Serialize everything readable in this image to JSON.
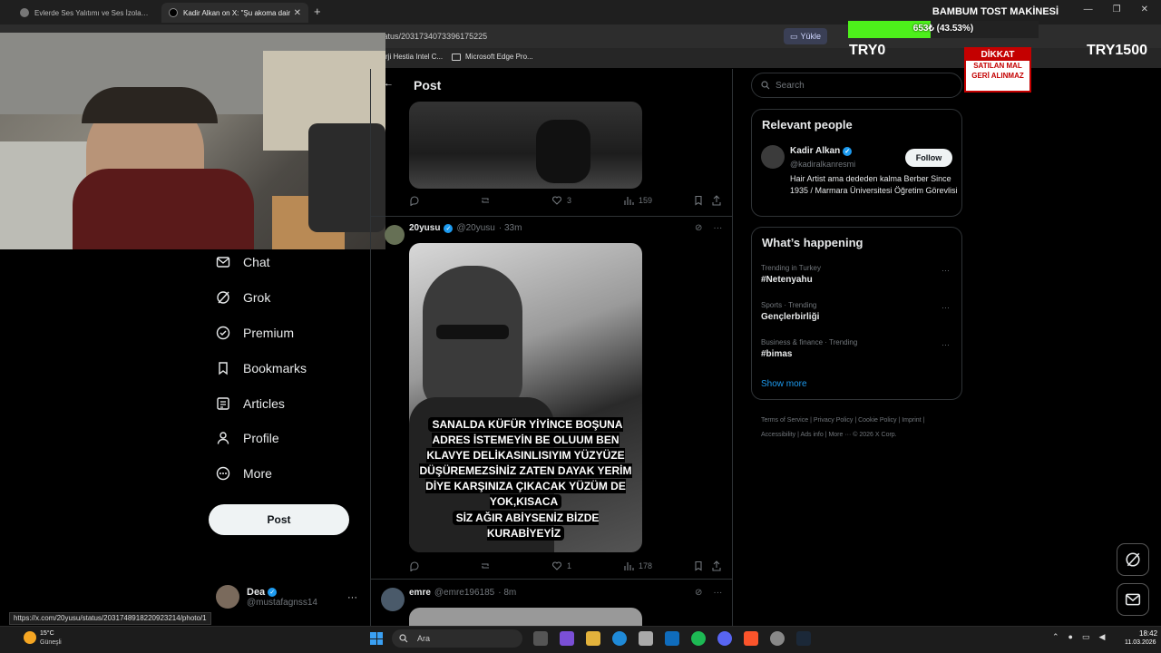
{
  "browser": {
    "tabs": [
      {
        "title": "Evlerde Ses Yalıtımı ve Ses İzolasyonu"
      },
      {
        "title": "Kadir Alkan on X: \"Şu akoma dair",
        "close": "✕"
      }
    ],
    "new_tab": "+",
    "url": "tatus/2031734073396175225",
    "yukle": "Yükle",
    "bookmarks": [
      "rji Hestia Intel C...",
      "Microsoft Edge Pro..."
    ],
    "status_url": "https://x.com/20yusu/status/2031748918220923214/photo/1"
  },
  "overlay": {
    "title": "BAMBUM TOST MAKİNESİ",
    "progress_text": "653₺ (43.53%)",
    "progress_fraction": 0.4353,
    "start": "TRY0",
    "goal": "TRY1500",
    "notice": {
      "head": "DİKKAT",
      "line1": "SATILAN MAL",
      "line2": "GERİ ALINMAZ"
    }
  },
  "nav": {
    "items": [
      {
        "label": "Chat",
        "icon": "chat-icon"
      },
      {
        "label": "Grok",
        "icon": "grok-icon"
      },
      {
        "label": "Premium",
        "icon": "premium-icon"
      },
      {
        "label": "Bookmarks",
        "icon": "bookmark-icon"
      },
      {
        "label": "Articles",
        "icon": "articles-icon"
      },
      {
        "label": "Profile",
        "icon": "profile-icon"
      },
      {
        "label": "More",
        "icon": "more-icon"
      }
    ],
    "post_label": "Post",
    "account": {
      "name": "Dea",
      "handle": "@mustafagnss14",
      "more": "···"
    }
  },
  "main": {
    "header": "Post",
    "back": "←",
    "tweet1": {
      "reply": "",
      "retweet": "",
      "likes": "3",
      "views": "159"
    },
    "tweet2": {
      "name": "20yusu",
      "handle": "@20yusu",
      "time": "· 33m",
      "caption_a": "SANALDA KÜFÜR YİYİNCE BOŞUNA ADRES İSTEMEYİN BE OLUUM BEN KLAVYE DELİKASINLISIYIM YÜZYÜZE DÜŞÜREMEZSİNİZ ZATEN DAYAK YERİM DİYE KARŞINIZA ÇIKACAK YÜZÜM DE YOK,KISACA",
      "caption_b": "SİZ AĞIR ABİYSENİZ BİZDE KURABİYEYİZ",
      "likes": "1",
      "views": "178"
    },
    "tweet3": {
      "name": "emre",
      "handle": "@emre196185",
      "time": "· 8m"
    }
  },
  "sidebar_right": {
    "search_placeholder": "Search",
    "relevant_title": "Relevant people",
    "person": {
      "name": "Kadir Alkan",
      "handle": "@kadiralkanresmi",
      "bio": "Hair Artist ama dededen kalma Berber Since 1935 / Marmara Üniversitesi Öğretim Görevlisi",
      "follow": "Follow"
    },
    "happening_title": "What’s happening",
    "trends": [
      {
        "category": "Trending in Turkey",
        "name": "#Netenyahu"
      },
      {
        "category": "Sports · Trending",
        "name": "Gençlerbirliği"
      },
      {
        "category": "Business & finance · Trending",
        "name": "#bimas"
      }
    ],
    "show_more": "Show more",
    "footer": "Terms of Service  |  Privacy Policy  |  Cookie Policy  |  Imprint  |  Accessibility  |  Ads info  |  More ···  © 2026 X Corp."
  },
  "taskbar": {
    "weather_temp": "15°C",
    "weather_desc": "Güneşli",
    "search": "Ara",
    "time": "18:42",
    "date": "11.03.2026"
  },
  "colors": {
    "accent": "#1d9bf0",
    "progress": "#4df01b",
    "notice_red": "#c40000"
  }
}
